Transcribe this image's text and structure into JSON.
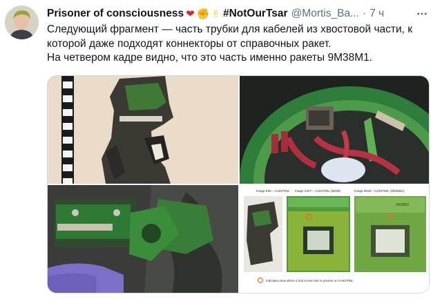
{
  "tweet": {
    "display_name": "Prisoner of consciousness",
    "emojis": [
      "❤",
      "✊",
      "✌"
    ],
    "hashtag": "#NotOurTsar",
    "handle": "@Mortis_Ba...",
    "separator": "·",
    "time": "7 ч",
    "text_lines": [
      "Следующий фрагмент — часть трубки для кабелей из хвостовой части, к",
      "которой даже подходят коннекторы от справочных ракет.",
      "На четвером кадре видно, что это часть именно ракеты 9М38М1."
    ]
  },
  "media": {
    "image4_labels": {
      "left_heading": "Image E06 – AA6370NL",
      "mid_heading": "Image K407 – AA6370NL (9M38)",
      "right_heading": "Image B026 – AA6370NL (9M38M1)",
      "legend": "Indicates area where a bolt screw hole is present on AA6370NL"
    }
  },
  "colors": {
    "link_gray": "#5b7083",
    "text": "#0f1419",
    "heart": "#d9252d",
    "border": "#cfd9de"
  }
}
